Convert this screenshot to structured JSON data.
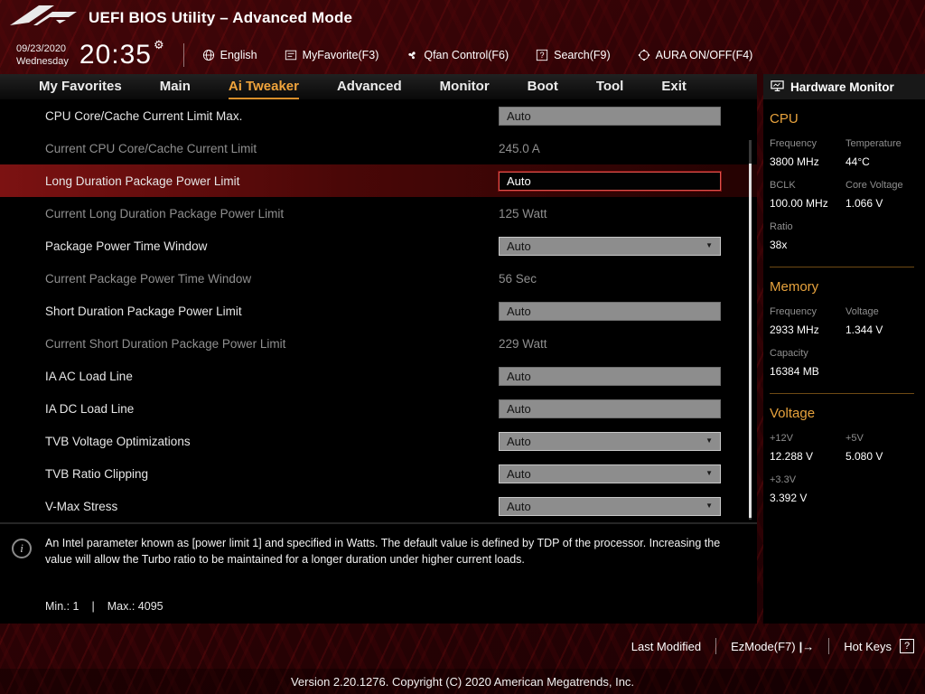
{
  "colors": {
    "accent_orange": "#efa53e",
    "section_title_orange": "#e8a33d",
    "rog_red_background": "#2a0203",
    "highlight_row_red": "#7c1212",
    "control_grey": "#8d8d8d"
  },
  "header": {
    "title": "UEFI BIOS Utility – Advanced Mode",
    "date": "09/23/2020",
    "day": "Wednesday",
    "time": "20:35",
    "toolbar": [
      {
        "label": "English"
      },
      {
        "label": "MyFavorite(F3)"
      },
      {
        "label": "Qfan Control(F6)"
      },
      {
        "label": "Search(F9)"
      },
      {
        "label": "AURA ON/OFF(F4)"
      }
    ]
  },
  "nav": {
    "tabs": [
      {
        "label": "My Favorites",
        "active": false
      },
      {
        "label": "Main",
        "active": false
      },
      {
        "label": "Ai Tweaker",
        "active": true
      },
      {
        "label": "Advanced",
        "active": false
      },
      {
        "label": "Monitor",
        "active": false
      },
      {
        "label": "Boot",
        "active": false
      },
      {
        "label": "Tool",
        "active": false
      },
      {
        "label": "Exit",
        "active": false
      }
    ]
  },
  "settings": [
    {
      "label": "CPU Core/Cache Current Limit Max.",
      "value": "Auto",
      "type": "input",
      "selected": false
    },
    {
      "label": "Current CPU Core/Cache Current Limit",
      "value": "245.0 A",
      "type": "readonly",
      "selected": false
    },
    {
      "label": "Long Duration Package Power Limit",
      "value": "Auto",
      "type": "input",
      "selected": true
    },
    {
      "label": "Current Long Duration Package Power Limit",
      "value": "125 Watt",
      "type": "readonly",
      "selected": false
    },
    {
      "label": "Package Power Time Window",
      "value": "Auto",
      "type": "dropdown",
      "selected": false
    },
    {
      "label": "Current Package Power Time Window",
      "value": "56 Sec",
      "type": "readonly",
      "selected": false
    },
    {
      "label": "Short Duration Package Power Limit",
      "value": "Auto",
      "type": "input",
      "selected": false
    },
    {
      "label": "Current Short Duration Package Power Limit",
      "value": "229 Watt",
      "type": "readonly",
      "selected": false
    },
    {
      "label": "IA AC Load Line",
      "value": "Auto",
      "type": "input",
      "selected": false
    },
    {
      "label": "IA DC Load Line",
      "value": "Auto",
      "type": "input",
      "selected": false
    },
    {
      "label": "TVB Voltage Optimizations",
      "value": "Auto",
      "type": "dropdown",
      "selected": false
    },
    {
      "label": "TVB Ratio Clipping",
      "value": "Auto",
      "type": "dropdown",
      "selected": false
    },
    {
      "label": "V-Max Stress",
      "value": "Auto",
      "type": "dropdown",
      "selected": false
    }
  ],
  "hardware_monitor": {
    "title": "Hardware Monitor",
    "sections": [
      {
        "title": "CPU",
        "rows": [
          [
            {
              "label": "Frequency",
              "value": "3800 MHz"
            },
            {
              "label": "Temperature",
              "value": "44°C"
            }
          ],
          [
            {
              "label": "BCLK",
              "value": "100.00 MHz"
            },
            {
              "label": "Core Voltage",
              "value": "1.066 V"
            }
          ],
          [
            {
              "label": "Ratio",
              "value": "38x"
            }
          ]
        ]
      },
      {
        "title": "Memory",
        "rows": [
          [
            {
              "label": "Frequency",
              "value": "2933 MHz"
            },
            {
              "label": "Voltage",
              "value": "1.344 V"
            }
          ],
          [
            {
              "label": "Capacity",
              "value": "16384 MB"
            }
          ]
        ]
      },
      {
        "title": "Voltage",
        "rows": [
          [
            {
              "label": "+12V",
              "value": "12.288 V"
            },
            {
              "label": "+5V",
              "value": "5.080 V"
            }
          ],
          [
            {
              "label": "+3.3V",
              "value": "3.392 V"
            }
          ]
        ]
      }
    ]
  },
  "help": {
    "text": "An Intel parameter known as [power limit 1] and specified in Watts. The default value is defined by TDP of the processor. Increasing the value will allow the Turbo ratio to be maintained for a longer duration under higher current loads.",
    "min": "Min.: 1",
    "separator": "|",
    "max": "Max.: 4095"
  },
  "footer": {
    "last_modified": "Last Modified",
    "ezmode_label": "EzMode(F7)",
    "ezmode_icon": "|→",
    "hotkeys_label": "Hot Keys",
    "hotkeys_icon": "?",
    "version": "Version 2.20.1276. Copyright (C) 2020 American Megatrends, Inc."
  }
}
